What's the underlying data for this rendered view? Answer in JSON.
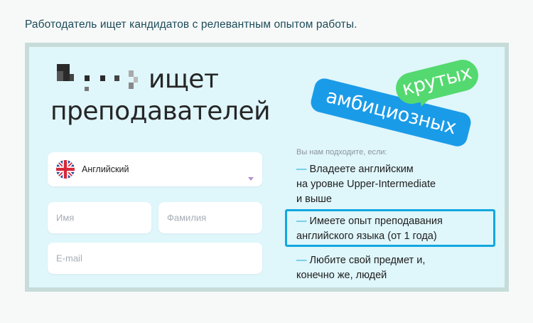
{
  "caption": "Работодатель ищет кандидатов с релевантным опытом работы.",
  "banner": {
    "headline_line1": "ищет",
    "headline_line2": "преподавателей",
    "badge_blue": "амбициозных",
    "badge_green": "крутых",
    "colors": {
      "background": "#dff6fb",
      "badge_blue": "#1a9be8",
      "badge_green": "#54d970",
      "highlight": "#12a7e0"
    }
  },
  "form": {
    "language_select": {
      "value": "Английский",
      "flag_icon": "uk-flag-icon"
    },
    "first_name_placeholder": "Имя",
    "last_name_placeholder": "Фамилия",
    "email_placeholder": "E-mail"
  },
  "requirements": {
    "intro": "Вы нам подходите, если:",
    "items": [
      {
        "dash": "—",
        "lines": [
          "Владеете английским",
          "на уровне Upper-Intermediate",
          "и выше"
        ]
      },
      {
        "dash": "—",
        "lines": [
          "Имеете опыт преподавания",
          "английского языка (от 1 года)"
        ],
        "highlighted": true
      },
      {
        "dash": "—",
        "lines": [
          "Любите свой предмет и,",
          "конечно же, людей"
        ]
      }
    ]
  }
}
